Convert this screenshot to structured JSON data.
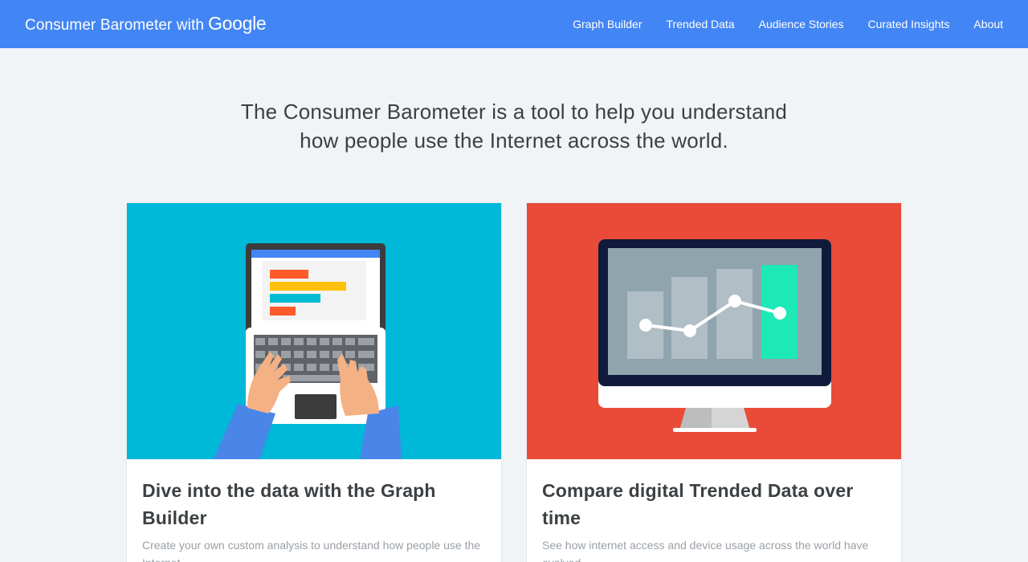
{
  "brand": {
    "text": "Consumer Barometer with",
    "logo": "Google"
  },
  "nav": [
    {
      "label": "Graph Builder"
    },
    {
      "label": "Trended Data"
    },
    {
      "label": "Audience Stories"
    },
    {
      "label": "Curated Insights"
    },
    {
      "label": "About"
    }
  ],
  "hero": {
    "line1": "The Consumer Barometer is a tool to help you understand",
    "line2": "how people use the Internet across the world."
  },
  "cards": [
    {
      "title": "Dive into the data with the Graph Builder",
      "description": "Create your own custom analysis to understand how people use the Internet.",
      "illustration": "laptop-icon",
      "color": "#00b8d7"
    },
    {
      "title": "Compare digital Trended Data over time",
      "description": "See how internet access and device usage across the world have evolved.",
      "illustration": "monitor-chart-icon",
      "color": "#ea4b38"
    }
  ],
  "colors": {
    "header": "#4285f4",
    "background": "#f1f4f7"
  }
}
